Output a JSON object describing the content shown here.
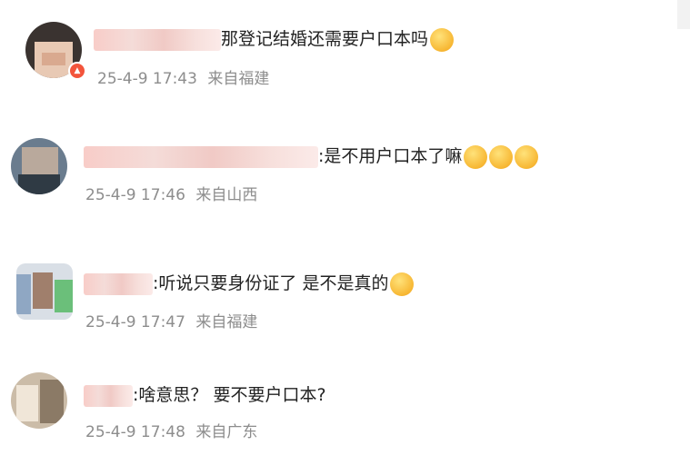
{
  "comments": [
    {
      "reply_text": "那登记结婚还需要户口本吗",
      "emojis": [
        "😂"
      ],
      "timestamp": "25-4-9 17:43",
      "location": "来自福建"
    },
    {
      "reply_text": ":是不用户口本了嘛",
      "emojis": [
        "🥳",
        "🥳",
        "🥳"
      ],
      "timestamp": "25-4-9 17:46",
      "location": "来自山西"
    },
    {
      "reply_text": ":听说只要身份证了 是不是真的",
      "emojis": [
        "🤓"
      ],
      "timestamp": "25-4-9 17:47",
      "location": "来自福建"
    },
    {
      "reply_text": ":啥意思？ 要不要户口本?",
      "emojis": [],
      "timestamp": "25-4-9 17:48",
      "location": "来自广东"
    }
  ],
  "colors": {
    "text": "#222222",
    "meta": "#8d8d8d",
    "badge": "#f3543b"
  }
}
